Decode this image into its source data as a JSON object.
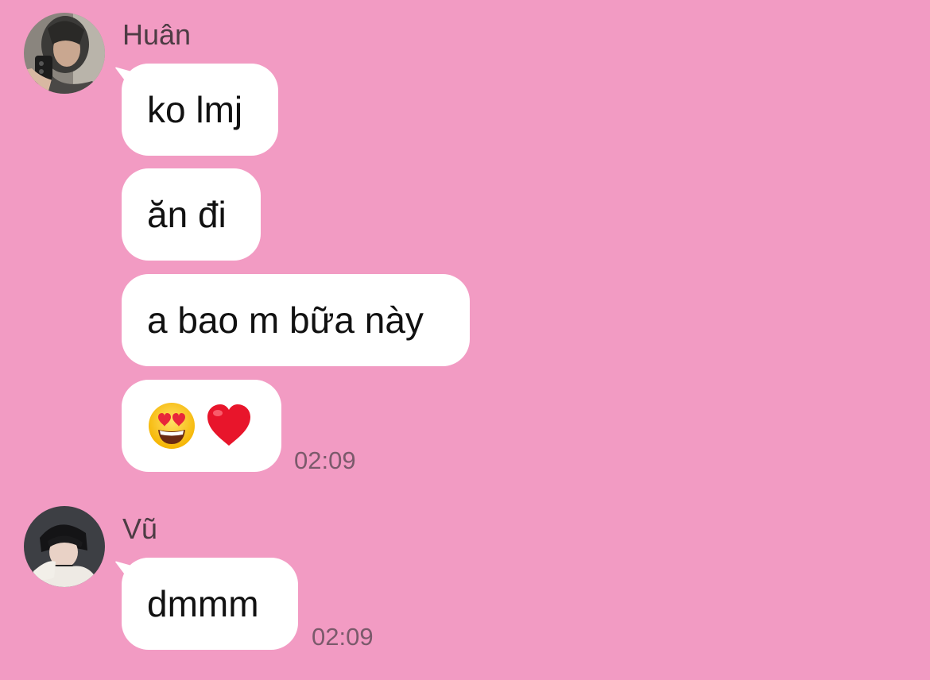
{
  "colors": {
    "background": "#f29bc3",
    "bubble": "#ffffff",
    "name_text": "#4d3c44",
    "timestamp_text": "#7b5a6b"
  },
  "messages_group_1": {
    "sender": "Huân",
    "avatar_icon": "user-avatar-huan",
    "bubbles": [
      "ko lmj",
      "ăn đi",
      "a bao m bữa này"
    ],
    "emoji_bubble": [
      "smiling-face-with-heart-eyes-icon",
      "red-heart-icon"
    ],
    "timestamp": "02:09"
  },
  "messages_group_2": {
    "sender": "Vũ",
    "avatar_icon": "user-avatar-vu",
    "bubbles": [
      "dmmm"
    ],
    "timestamp": "02:09"
  }
}
